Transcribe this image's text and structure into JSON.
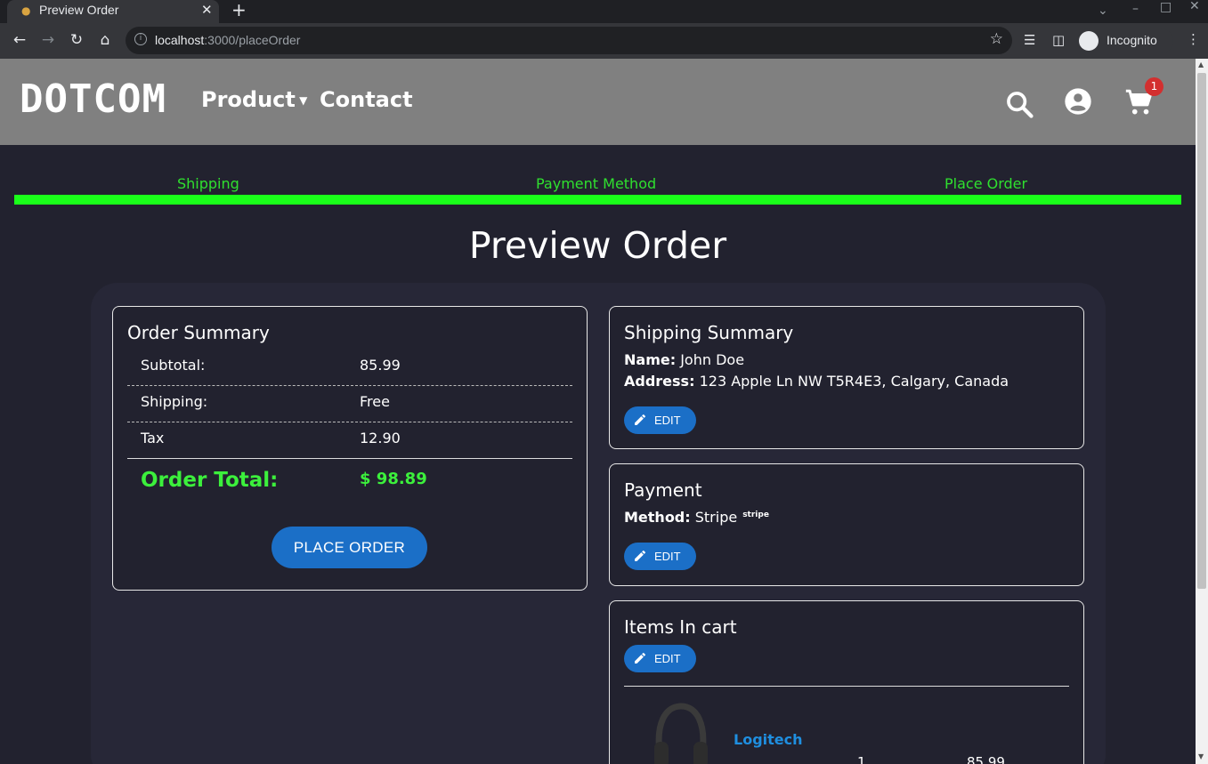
{
  "browser": {
    "tab_title": "Preview Order",
    "url_host": "localhost",
    "url_path": ":3000/placeOrder",
    "profile_label": "Incognito"
  },
  "header": {
    "logo": "DOTCOM",
    "nav": {
      "product": "Product",
      "contact": "Contact"
    },
    "cart_count": "1"
  },
  "steps": [
    "Shipping",
    "Payment Method",
    "Place Order"
  ],
  "page_title": "Preview Order",
  "order_summary": {
    "title": "Order Summary",
    "rows": [
      {
        "label": "Subtotal:",
        "value": "85.99"
      },
      {
        "label": "Shipping:",
        "value": "Free"
      },
      {
        "label": "Tax",
        "value": "12.90"
      }
    ],
    "total_label": "Order Total:",
    "total_value": "$ 98.89",
    "place_order_label": "PLACE ORDER"
  },
  "shipping_summary": {
    "title": "Shipping Summary",
    "name_label": "Name:",
    "name": "John Doe",
    "address_label": "Address:",
    "address": "123 Apple Ln NW T5R4E3, Calgary, Canada",
    "edit_label": "EDIT"
  },
  "payment": {
    "title": "Payment",
    "method_label": "Method:",
    "method": "Stripe",
    "method_mark": "stripe",
    "edit_label": "EDIT"
  },
  "cart_items": {
    "title": "Items In cart",
    "edit_label": "EDIT",
    "items": [
      {
        "name": "Logitech",
        "qty": "1",
        "price": "85.99"
      }
    ]
  },
  "colors": {
    "accent_green": "#1aff1a",
    "button_blue": "#1b6fc7",
    "header_gray": "#808080",
    "page_bg": "#22222f",
    "badge_red": "#d32f2f"
  },
  "icons": [
    "search-icon",
    "account-icon",
    "cart-icon",
    "edit-pencil-icon"
  ]
}
